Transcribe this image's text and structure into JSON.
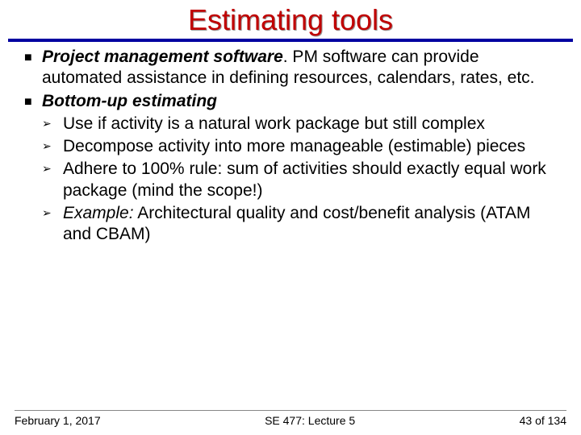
{
  "title": "Estimating tools",
  "bullets": {
    "b1_a_label": "Project management software",
    "b1_a_rest": ". PM software can provide automated assistance in defining resources, calendars, rates, etc.",
    "b1_b_label": "Bottom-up estimating",
    "b2_1": "Use if activity is a natural work package but still complex",
    "b2_2": "Decompose activity into more manageable (estimable) pieces",
    "b2_3": "Adhere to 100% rule: sum of activities should exactly equal work package (mind the scope!)",
    "b2_4_label": "Example:",
    "b2_4_rest": " Architectural quality and cost/benefit analysis (ATAM and CBAM)"
  },
  "footer": {
    "date": "February 1, 2017",
    "center": "SE 477: Lecture 5",
    "page": "43 of 134"
  }
}
